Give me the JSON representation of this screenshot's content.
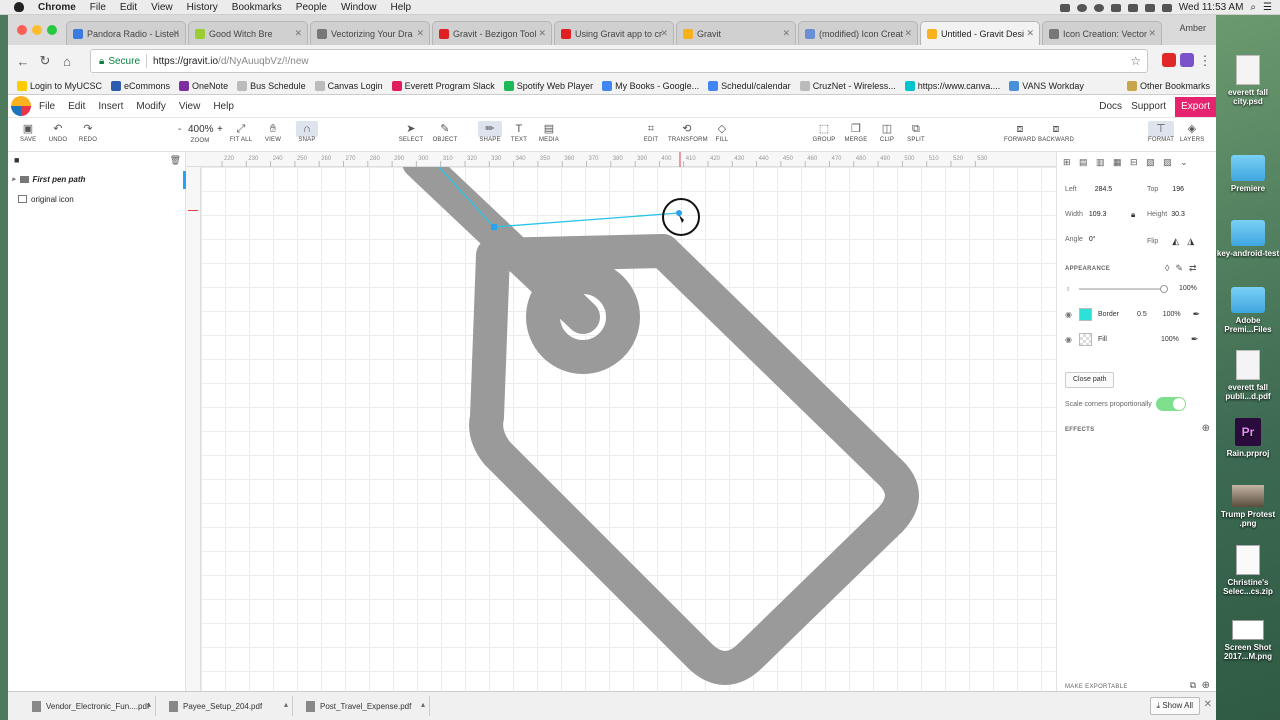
{
  "mac_menu": {
    "app": "Chrome",
    "items": [
      "File",
      "Edit",
      "View",
      "History",
      "Bookmarks",
      "People",
      "Window",
      "Help"
    ],
    "clock": "Wed 11:53 AM",
    "user": "Amber"
  },
  "tabs": [
    {
      "title": "Pandora Radio - Listen",
      "color": "#3b7be0"
    },
    {
      "title": "Good Witch Bre",
      "color": "#9acd32"
    },
    {
      "title": "Vectorizing Your Dra",
      "color": "#777777"
    },
    {
      "title": "Gravit - Bezigon Tool",
      "color": "#e02020"
    },
    {
      "title": "Using Gravit app to cr",
      "color": "#e02020"
    },
    {
      "title": "Gravit",
      "color": "#f9b21d"
    },
    {
      "title": "(modified) Icon Creat",
      "color": "#6a8fd6"
    },
    {
      "title": "Untitled - Gravit Desi",
      "color": "#f9b21d",
      "active": true
    },
    {
      "title": "Icon Creation: Vector",
      "color": "#777777"
    }
  ],
  "address": {
    "secure_label": "Secure",
    "url_main": "https://gravit.io",
    "url_rest": "/d/NyAuuqbVz/!/new"
  },
  "bookmarks": [
    {
      "label": "Login to MyUCSC",
      "color": "#ffcc00"
    },
    {
      "label": "eCommons",
      "color": "#2a5db0"
    },
    {
      "label": "OneNote",
      "color": "#7b2fa0"
    },
    {
      "label": "Bus Schedule",
      "color": "#bbbbbb"
    },
    {
      "label": "Canvas Login",
      "color": "#bbbbbb"
    },
    {
      "label": "Everett Program Slack",
      "color": "#e01e5a"
    },
    {
      "label": "Spotify Web Player",
      "color": "#1db954"
    },
    {
      "label": "My Books - Google...",
      "color": "#4285f4"
    },
    {
      "label": "Schedul/calendar",
      "color": "#4285f4"
    },
    {
      "label": "CruzNet - Wireless...",
      "color": "#bbbbbb"
    },
    {
      "label": "https://www.canva....",
      "color": "#00c4cc"
    },
    {
      "label": "VANS Workday",
      "color": "#4a90d9"
    }
  ],
  "other_bookmarks": "Other Bookmarks",
  "app_menu": {
    "items": [
      "File",
      "Edit",
      "Insert",
      "Modify",
      "View",
      "Help"
    ],
    "docs": "Docs",
    "support": "Support",
    "export": "Export"
  },
  "toolbar": {
    "save": "SAVE",
    "undo": "UNDO",
    "redo": "REDO",
    "zoom_value": "400%",
    "zoom": "ZOOM",
    "fit_all": "FIT ALL",
    "view": "VIEW",
    "snap": "SNAP",
    "select": "SELECT",
    "object": "OBJECT",
    "shape": "SHAPE",
    "text": "TEXT",
    "media": "MEDIA",
    "edit": "EDIT",
    "transform": "TRANSFORM",
    "fill": "FILL",
    "group": "GROUP",
    "merge": "MERGE",
    "clip": "CLIP",
    "split": "SPLIT",
    "forward": "FORWARD",
    "backward": "BACKWARD",
    "format": "FORMAT",
    "layers": "LAYERS"
  },
  "layers": [
    {
      "name": "First pen path",
      "type": "group"
    },
    {
      "name": "original icon",
      "type": "image"
    }
  ],
  "ruler": {
    "top_ticks": [
      "220",
      "230",
      "240",
      "250",
      "260",
      "270",
      "280",
      "290",
      "300",
      "310",
      "320",
      "330",
      "340",
      "350",
      "360",
      "370",
      "380",
      "390",
      "400",
      "410",
      "420",
      "430",
      "440",
      "450",
      "460",
      "470",
      "480",
      "490",
      "500",
      "510",
      "520",
      "530"
    ]
  },
  "inspector": {
    "left_label": "Left",
    "left_value": "284.5",
    "top_label": "Top",
    "top_value": "196",
    "width_label": "Width",
    "width_value": "109.3",
    "height_label": "Height",
    "height_value": "30.3",
    "angle_label": "Angle",
    "angle_value": "0°",
    "flip_label": "Flip",
    "appearance": "APPEARANCE",
    "opacity": "100%",
    "border_label": "Border",
    "border_width": "0.5",
    "border_opacity": "100%",
    "border_color": "#2de0d8",
    "fill_label": "Fill",
    "fill_opacity": "100%",
    "close_path": "Close path",
    "scale_corners": "Scale corners proportionally",
    "effects": "EFFECTS",
    "make_exportable": "MAKE EXPORTABLE"
  },
  "downloads": [
    {
      "name": "Vendor_Electronic_Fun....pdf"
    },
    {
      "name": "Payee_Setup_204.pdf"
    },
    {
      "name": "Post_Travel_Expense.pdf"
    }
  ],
  "show_all": "Show All",
  "desktop_items": [
    {
      "label": "everett fall city.psd",
      "kind": "doc"
    },
    {
      "label": "Premiere",
      "kind": "folder"
    },
    {
      "label": "key-android-test",
      "kind": "folder"
    },
    {
      "label": "Adobe Premi...Files",
      "kind": "folder"
    },
    {
      "label": "everett fall publi...d.pdf",
      "kind": "doc"
    },
    {
      "label": "Rain.prproj",
      "kind": "pr"
    },
    {
      "label": "Trump Protest .png",
      "kind": "photo"
    },
    {
      "label": "Christine's Selec...cs.zip",
      "kind": "zip"
    },
    {
      "label": "Screen Shot 2017...M.png",
      "kind": "shot"
    }
  ],
  "colors": {
    "accent": "#e6236e",
    "selection": "#29a2f2",
    "path_stroke": "#29c4e8",
    "icon_gray": "#9a9a9a"
  }
}
